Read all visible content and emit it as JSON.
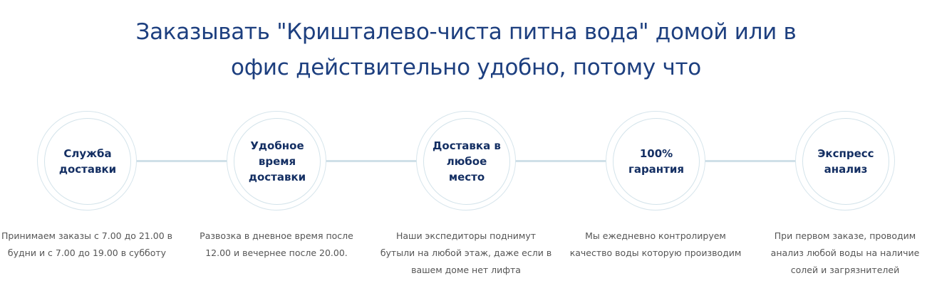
{
  "header": {
    "title_line1": "Заказывать \"Кришталево-чиста питна вода\" домой или в",
    "title_line2": "офис действительно удобно, потому что"
  },
  "features": [
    {
      "title": "Служба доставки",
      "description": "Принимаем заказы с 7.00 до 21.00 в будни и с 7.00 до 19.00 в субботу"
    },
    {
      "title": "Удобное время доставки",
      "description": "Развозка в дневное время после 12.00 и вечернее после 20.00."
    },
    {
      "title": "Доставка в любое место",
      "description": "Наши экспедиторы поднимут бутыли на любой этаж, даже если в вашем доме нет лифта"
    },
    {
      "title": "100% гарантия",
      "description": "Мы ежедневно контролируем качество воды которую производим"
    },
    {
      "title": "Экспресс анализ",
      "description": "При первом заказе, проводим анализ любой воды на наличие солей и загрязнителей"
    }
  ],
  "colors": {
    "title": "#1d3f7f",
    "circle_text": "#142f63",
    "ring": "#d7e5ec",
    "connector": "#cfe0e8",
    "description": "#555555"
  }
}
